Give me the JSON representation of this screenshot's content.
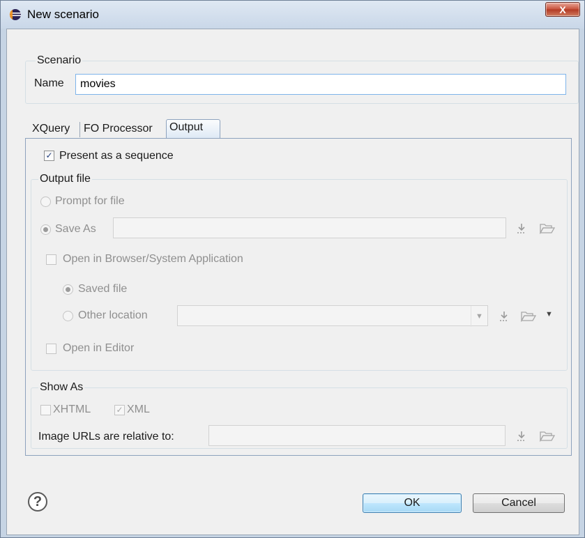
{
  "window": {
    "title": "New scenario",
    "close_label": "X"
  },
  "scenario": {
    "group_label": "Scenario",
    "name_label": "Name",
    "name_value": "movies"
  },
  "tabs": [
    {
      "label": "XQuery",
      "selected": false
    },
    {
      "label": "FO Processor",
      "selected": false
    },
    {
      "label": "Output",
      "selected": true
    }
  ],
  "output": {
    "present_as_sequence": {
      "label": "Present as a sequence",
      "checked": true
    },
    "output_file": {
      "group_label": "Output file",
      "prompt_for_file": {
        "label": "Prompt for file",
        "selected": false
      },
      "save_as": {
        "label": "Save As",
        "selected": true,
        "value": ""
      },
      "open_in_browser": {
        "label": "Open in Browser/System Application",
        "checked": false
      },
      "saved_file": {
        "label": "Saved file",
        "selected": true
      },
      "other_location": {
        "label": "Other location",
        "selected": false,
        "value": ""
      },
      "open_in_editor": {
        "label": "Open in Editor",
        "checked": false
      }
    },
    "show_as": {
      "group_label": "Show As",
      "xhtml": {
        "label": "XHTML",
        "checked": false
      },
      "xml": {
        "label": "XML",
        "checked": true
      },
      "image_urls_label": "Image URLs are relative to:",
      "image_urls_value": ""
    }
  },
  "buttons": {
    "ok": "OK",
    "cancel": "Cancel",
    "help": "?"
  },
  "icons": {
    "title": "eclipse-icon",
    "insert_editor_variables": "insert-variables-icon",
    "browse": "folder-open-icon",
    "dropdown": "chevron-down-icon",
    "help": "help-icon"
  },
  "colors": {
    "titlebar": "#c9d7e8",
    "close_button": "#c7503a",
    "default_button": "#bee6fd",
    "focus_border": "#7eb4ea"
  }
}
